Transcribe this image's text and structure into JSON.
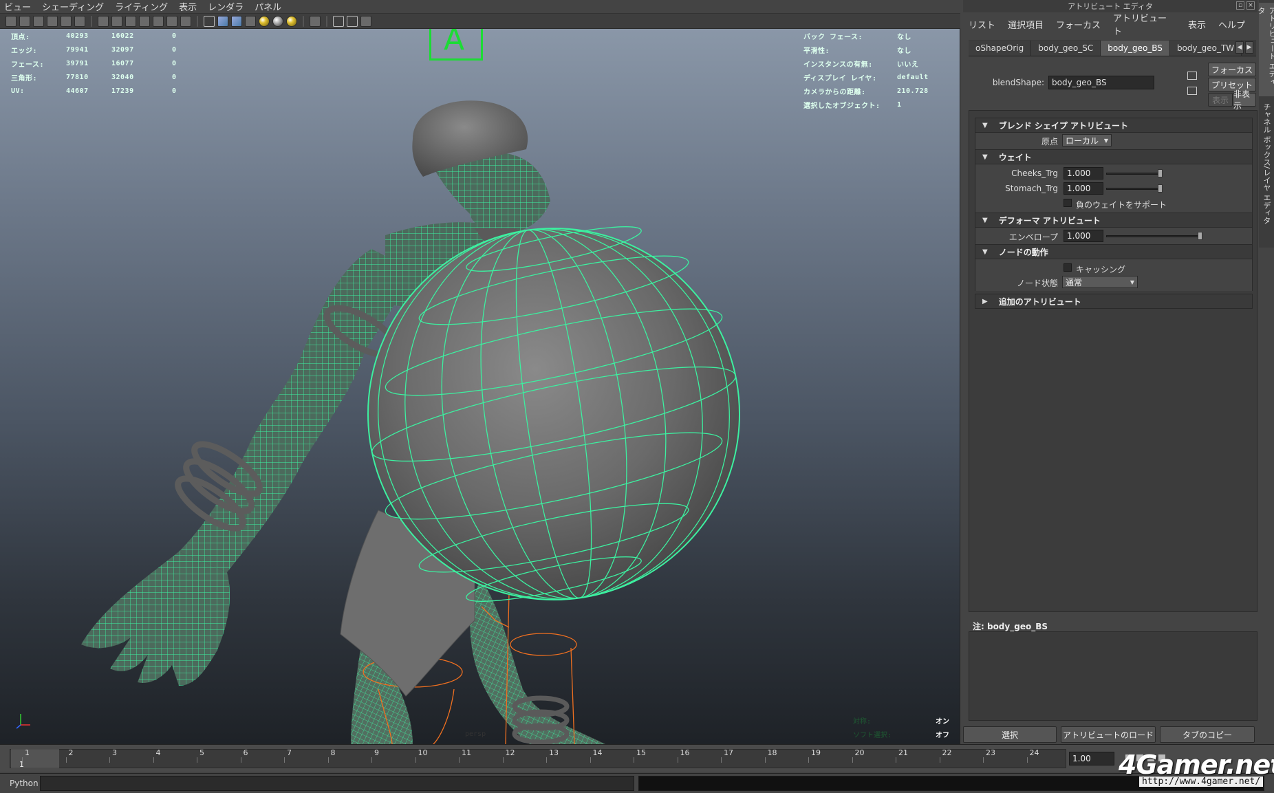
{
  "viewport": {
    "menu": [
      "ビュー",
      "シェーディング",
      "ライティング",
      "表示",
      "レンダラ",
      "パネル"
    ],
    "hud_left": [
      {
        "label": "頂点:",
        "v1": "40293",
        "v2": "16022",
        "v3": "0"
      },
      {
        "label": "エッジ:",
        "v1": "79941",
        "v2": "32097",
        "v3": "0"
      },
      {
        "label": "フェース:",
        "v1": "39791",
        "v2": "16077",
        "v3": "0"
      },
      {
        "label": "三角形:",
        "v1": "77810",
        "v2": "32040",
        "v3": "0"
      },
      {
        "label": "UV:",
        "v1": "44607",
        "v2": "17239",
        "v3": "0"
      }
    ],
    "hud_right": [
      {
        "label": "バック フェース:",
        "value": "なし"
      },
      {
        "label": "平滑性:",
        "value": "なし"
      },
      {
        "label": "インスタンスの有無:",
        "value": "いいえ"
      },
      {
        "label": "ディスプレイ レイヤ:",
        "value": "default"
      },
      {
        "label": "カメラからの距離:",
        "value": "210.728"
      },
      {
        "label": "選択したオブジェクト:",
        "value": "1"
      }
    ],
    "gizmo_letter": "A",
    "bottom_hud": [
      {
        "label": "対称:",
        "value": "オン"
      },
      {
        "label": "ソフト選択:",
        "value": "オフ"
      }
    ],
    "camera_label": "persp",
    "colors": {
      "wire": "#3cf0a0",
      "rig": "#f07020",
      "gizmo": "#1cdc34"
    }
  },
  "attribute_editor": {
    "title": "アトリビュート エディタ",
    "menu": [
      "リスト",
      "選択項目",
      "フォーカス",
      "アトリビュート",
      "表示",
      "ヘルプ"
    ],
    "tabs": [
      {
        "label": "oShapeOrig",
        "active": false
      },
      {
        "label": "body_geo_SC",
        "active": false
      },
      {
        "label": "body_geo_BS",
        "active": true
      },
      {
        "label": "body_geo_TW",
        "active": false
      }
    ],
    "node_label": "blendShape:",
    "node_value": "body_geo_BS",
    "buttons": {
      "focus": "フォーカス",
      "preset": "プリセット",
      "show": "表示",
      "hide": "非表示"
    },
    "sections": {
      "blend": {
        "title": "ブレンド シェイプ アトリビュート",
        "origin_label": "原点",
        "origin_value": "ローカル"
      },
      "weight": {
        "title": "ウェイト",
        "items": [
          {
            "label": "Cheeks_Trg",
            "value": "1.000",
            "level": 1.0
          },
          {
            "label": "Stomach_Trg",
            "value": "1.000",
            "level": 1.0
          }
        ],
        "negative_label": "負のウェイトをサポート"
      },
      "deformer": {
        "title": "デフォーマ アトリビュート",
        "envelope_label": "エンベロープ",
        "envelope_value": "1.000",
        "envelope_level": 1.0
      },
      "node": {
        "title": "ノードの動作",
        "caching_label": "キャッシング",
        "state_label": "ノード状態",
        "state_value": "通常"
      },
      "extra": {
        "title": "追加のアトリビュート"
      }
    },
    "notes_label": "注:  body_geo_BS",
    "bottom_buttons": [
      "選択",
      "アトリビュートのロード",
      "タブのコピー"
    ],
    "side_tabs": [
      "アトリビュート エディタ",
      "チャネル ボックス/レイヤ エディタ"
    ]
  },
  "timeline": {
    "frames": [
      "1",
      "2",
      "3",
      "4",
      "5",
      "6",
      "7",
      "8",
      "9",
      "10",
      "11",
      "12",
      "13",
      "14",
      "15",
      "16",
      "17",
      "18",
      "19",
      "20",
      "21",
      "22",
      "23",
      "24"
    ],
    "current_frame": "1",
    "frame_field": "1.00"
  },
  "command_line": {
    "label": "Python"
  },
  "watermark": {
    "brand": "4Gamer.net",
    "url": "http://www.4gamer.net/"
  }
}
